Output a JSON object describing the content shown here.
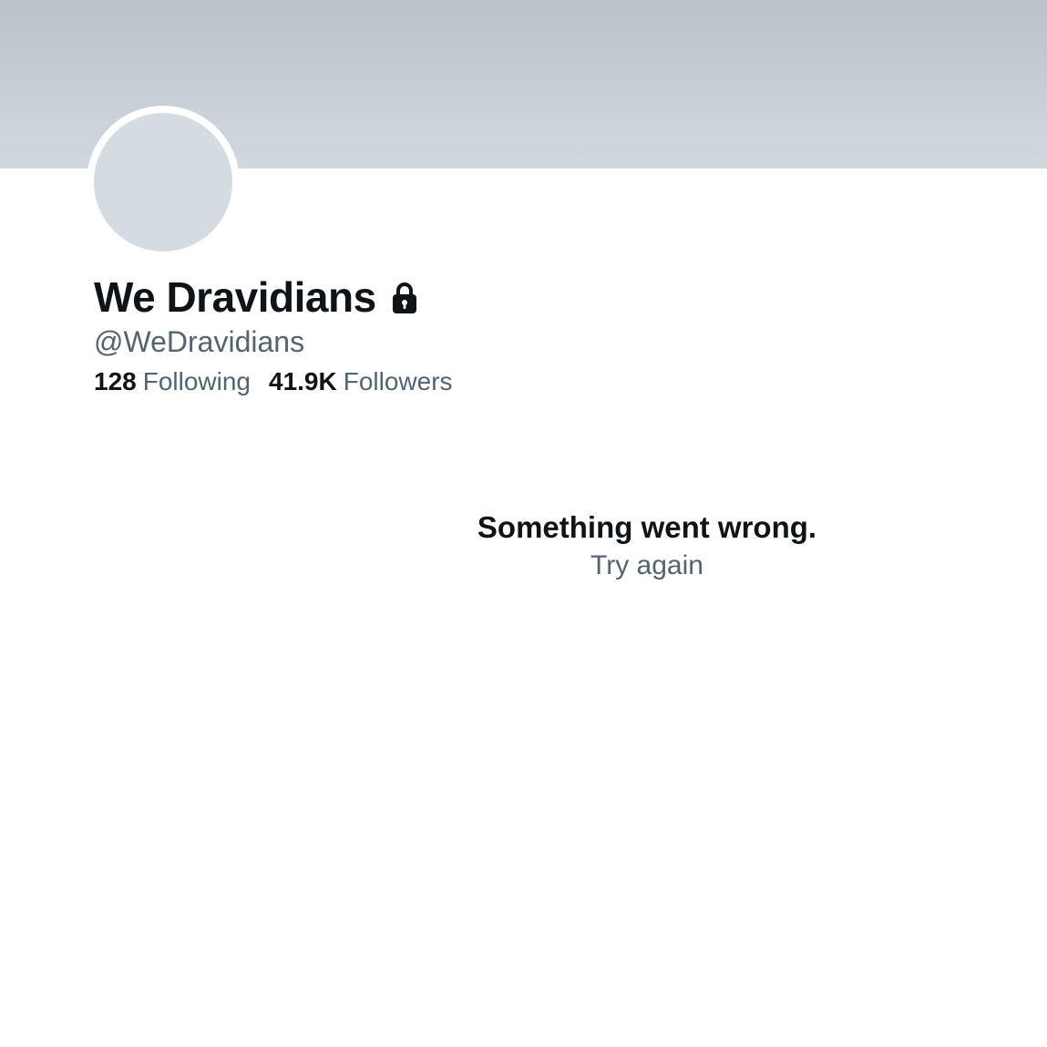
{
  "profile": {
    "display_name": "We Dravidians",
    "handle": "@WeDravidians",
    "protected_icon": "lock-icon",
    "stats": {
      "following_count": "128",
      "following_label": "Following",
      "followers_count": "41.9K",
      "followers_label": "Followers"
    }
  },
  "error": {
    "title": "Something went wrong.",
    "retry_label": "Try again"
  },
  "colors": {
    "text_primary": "#0f1419",
    "text_secondary": "#536471",
    "banner_top": "#bbc3ca",
    "banner_bottom": "#cfd9de",
    "avatar_placeholder": "#d4dce2"
  }
}
